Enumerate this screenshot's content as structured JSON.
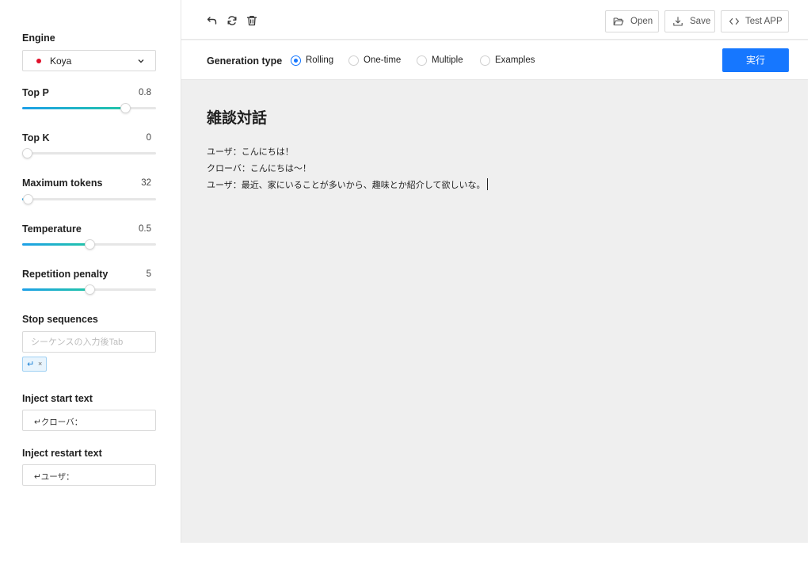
{
  "sidebar": {
    "engine": {
      "label": "Engine",
      "selected": "Koya",
      "dot_color": "#e0102a"
    },
    "params": [
      {
        "label": "Top P",
        "value": "0.8",
        "fill": 0.77
      },
      {
        "label": "Top K",
        "value": "0",
        "fill": 0.0
      },
      {
        "label": "Maximum tokens",
        "value": "32",
        "fill": 0.04
      },
      {
        "label": "Temperature",
        "value": "0.5",
        "fill": 0.5
      },
      {
        "label": "Repetition penalty",
        "value": "5",
        "fill": 0.5
      }
    ],
    "stop_sequences": {
      "label": "Stop sequences",
      "placeholder": "シーケンスの入力後Tab",
      "tags": [
        {
          "symbol": "↵",
          "remove": "×"
        }
      ]
    },
    "inject_start": {
      "label": "Inject start text",
      "value": "↵クローバ："
    },
    "inject_restart": {
      "label": "Inject restart text",
      "value": "↵ユーザ："
    }
  },
  "toolbar": {
    "undo_icon": "undo-icon",
    "refresh_icon": "refresh-icon",
    "trash_icon": "trash-icon",
    "open_label": "Open",
    "save_label": "Save",
    "test_app_label": "Test APP"
  },
  "generation": {
    "label": "Generation type",
    "options": [
      "Rolling",
      "One-time",
      "Multiple",
      "Examples"
    ],
    "selected": "Rolling",
    "run_label": "実行"
  },
  "editor": {
    "title": "雑談対話",
    "lines": [
      "ユーザ：こんにちは！",
      "クローバ：こんにちは～！",
      "ユーザ：最近、家にいることが多いから、趣味とか紹介して欲しいな。"
    ]
  },
  "colors": {
    "accent": "#1677ff",
    "slider_gradient_start": "#1ea0e8",
    "slider_gradient_end": "#22c5a8",
    "editor_bg": "#efefef"
  }
}
